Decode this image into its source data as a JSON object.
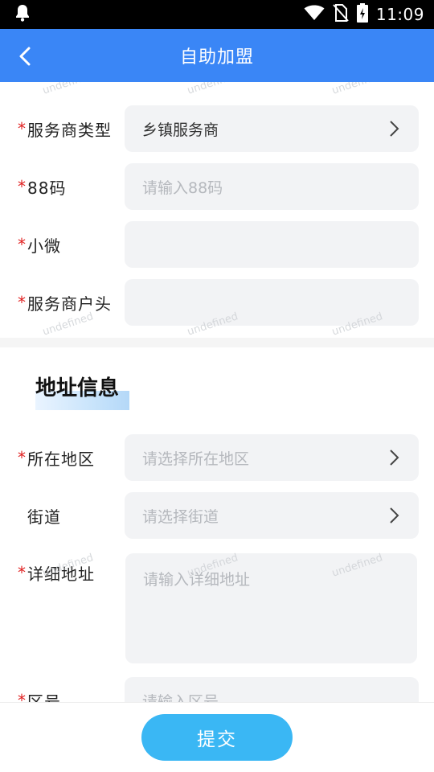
{
  "status_bar": {
    "time": "11:09",
    "icons": [
      "notification-bell-icon",
      "wifi-icon",
      "no-sim-icon",
      "battery-charging-icon"
    ]
  },
  "header": {
    "title": "自助加盟",
    "back_icon": "chevron-left-icon"
  },
  "watermark_text": "undefined",
  "form": {
    "service_type": {
      "label": "服务商类型",
      "required": "*",
      "value": "乡镇服务商"
    },
    "code88": {
      "label": "88码",
      "required": "*",
      "placeholder": "请输入88码"
    },
    "xiaowei": {
      "label": "小微",
      "required": "*",
      "value": ""
    },
    "account_head": {
      "label": "服务商户头",
      "required": "*",
      "value": ""
    }
  },
  "address_section": {
    "title": "地址信息",
    "region": {
      "label": "所在地区",
      "required": "*",
      "placeholder": "请选择所在地区"
    },
    "street": {
      "label": "街道",
      "placeholder": "请选择街道"
    },
    "detail": {
      "label": "详细地址",
      "required": "*",
      "placeholder": "请输入详细地址"
    },
    "district_no": {
      "label": "区号",
      "required": "*",
      "placeholder": "请输入区号"
    }
  },
  "actions": {
    "submit_label": "提交"
  },
  "colors": {
    "header_bg": "#3a86f6",
    "submit_bg": "#3ab7f4",
    "required": "#e02020",
    "field_bg": "#f2f3f5"
  }
}
